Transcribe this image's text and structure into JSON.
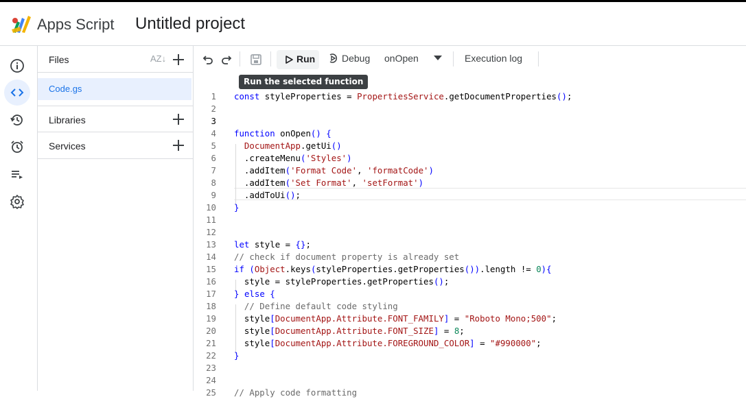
{
  "app": {
    "brand": "Apps Script",
    "project_title": "Untitled project"
  },
  "rail": {
    "items": [
      {
        "name": "overview",
        "icon": "info-icon",
        "active": false
      },
      {
        "name": "editor",
        "icon": "code-icon",
        "active": true
      },
      {
        "name": "triggers-history",
        "icon": "history-icon",
        "active": false
      },
      {
        "name": "triggers",
        "icon": "alarm-icon",
        "active": false
      },
      {
        "name": "executions",
        "icon": "list-play-icon",
        "active": false
      },
      {
        "name": "settings",
        "icon": "gear-icon",
        "active": false
      }
    ]
  },
  "files_panel": {
    "files_label": "Files",
    "sort_label": "AZ",
    "file_name": "Code.gs",
    "libraries_label": "Libraries",
    "services_label": "Services"
  },
  "toolbar": {
    "run_label": "Run",
    "debug_label": "Debug",
    "function_name": "onOpen",
    "execution_log_label": "Execution log",
    "tooltip": "Run the selected function"
  },
  "editor": {
    "current_line": 3,
    "lines": [
      "const styleProperties = PropertiesService.getDocumentProperties();",
      "",
      "",
      "function onOpen() {",
      "  DocumentApp.getUi()",
      "  .createMenu('Styles')",
      "  .addItem('Format Code', 'formatCode')",
      "  .addItem('Set Format', 'setFormat')",
      "  .addToUi();",
      "}",
      "",
      "",
      "let style = {};",
      "// check if document property is already set",
      "if (Object.keys(styleProperties.getProperties()).length != 0){",
      "  style = styleProperties.getProperties();",
      "} else {",
      "  // Define default code styling",
      "  style[DocumentApp.Attribute.FONT_FAMILY] = \"Roboto Mono;500\";",
      "  style[DocumentApp.Attribute.FONT_SIZE] = 8;",
      "  style[DocumentApp.Attribute.FOREGROUND_COLOR] = \"#990000\";",
      "}",
      "",
      "",
      "// Apply code formatting"
    ]
  },
  "colors": {
    "accent": "#1a73e8",
    "selected_bg": "#e8f0fe",
    "tooltip_bg": "#3c4043"
  }
}
